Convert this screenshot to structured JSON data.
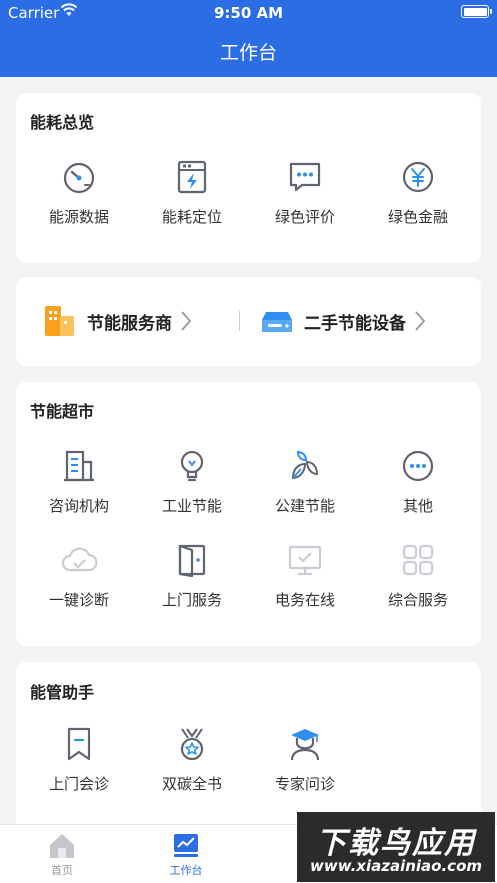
{
  "status_bar": {
    "carrier": "Carrier",
    "time": "9:50 AM"
  },
  "header": {
    "title": "工作台"
  },
  "energy_overview": {
    "title": "能耗总览",
    "items": [
      {
        "label": "能源数据",
        "icon": "gauge-icon"
      },
      {
        "label": "能耗定位",
        "icon": "meter-icon"
      },
      {
        "label": "绿色评价",
        "icon": "chat-icon"
      },
      {
        "label": "绿色金融",
        "icon": "yuan-icon"
      }
    ]
  },
  "services": {
    "items": [
      {
        "label": "节能服务商",
        "icon": "building-icon"
      },
      {
        "label": "二手节能设备",
        "icon": "device-icon"
      }
    ]
  },
  "market": {
    "title": "节能超市",
    "items": [
      {
        "label": "咨询机构",
        "icon": "office-icon"
      },
      {
        "label": "工业节能",
        "icon": "bulb-icon"
      },
      {
        "label": "公建节能",
        "icon": "leaves-icon"
      },
      {
        "label": "其他",
        "icon": "more-icon"
      },
      {
        "label": "一键诊断",
        "icon": "cloud-check-icon"
      },
      {
        "label": "上门服务",
        "icon": "door-icon"
      },
      {
        "label": "电务在线",
        "icon": "monitor-icon"
      },
      {
        "label": "综合服务",
        "icon": "grid-icon"
      }
    ]
  },
  "assistant": {
    "title": "能管助手",
    "items": [
      {
        "label": "上门会诊",
        "icon": "bookmark-icon"
      },
      {
        "label": "双碳全书",
        "icon": "medal-icon"
      },
      {
        "label": "专家问诊",
        "icon": "expert-icon"
      }
    ]
  },
  "tabbar": {
    "items": [
      {
        "label": "首页",
        "icon": "home-icon"
      },
      {
        "label": "工作台",
        "icon": "dashboard-icon"
      }
    ]
  },
  "watermark": {
    "big": "下载鸟应用",
    "small": "www.xiazainiao.com"
  },
  "colors": {
    "primary": "#2b6de5",
    "icon_gray": "#5f6470",
    "accent_orange": "#f7a21b",
    "accent_blue": "#2f8ff0"
  }
}
